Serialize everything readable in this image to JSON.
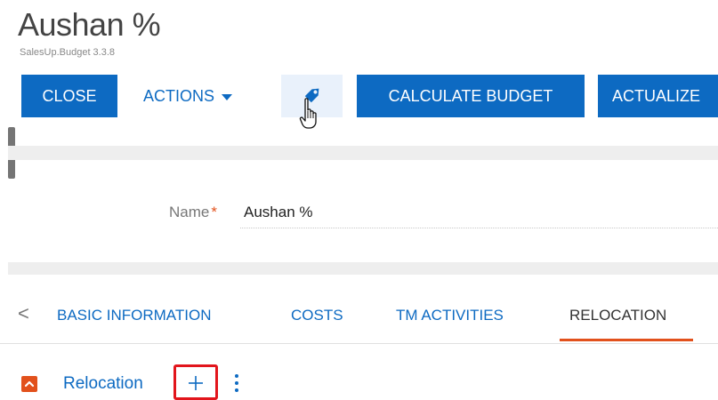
{
  "page": {
    "title": "Aushan %",
    "version": "SalesUp.Budget 3.3.8"
  },
  "toolbar": {
    "close_label": "CLOSE",
    "actions_label": "ACTIONS",
    "tag_icon": "tag-icon",
    "calculate_label": "CALCULATE BUDGET",
    "actualize_label": "ACTUALIZE"
  },
  "form": {
    "name_label": "Name",
    "required_mark": "*",
    "name_value": "Aushan %"
  },
  "tabs": {
    "prev_glyph": "<",
    "items": [
      {
        "label": "BASIC INFORMATION"
      },
      {
        "label": "COSTS"
      },
      {
        "label": "TM ACTIVITIES"
      },
      {
        "label": "RELOCATION",
        "active": true
      }
    ]
  },
  "section": {
    "title": "Relocation",
    "collapse_icon": "chevron-up-icon",
    "add_icon": "plus-icon",
    "more_icon": "more-vertical-icon"
  },
  "colors": {
    "primary": "#0d6ac2",
    "accent": "#e2511c",
    "highlight_border": "#e2151c",
    "tag_button_bg": "#e9f1fb"
  }
}
